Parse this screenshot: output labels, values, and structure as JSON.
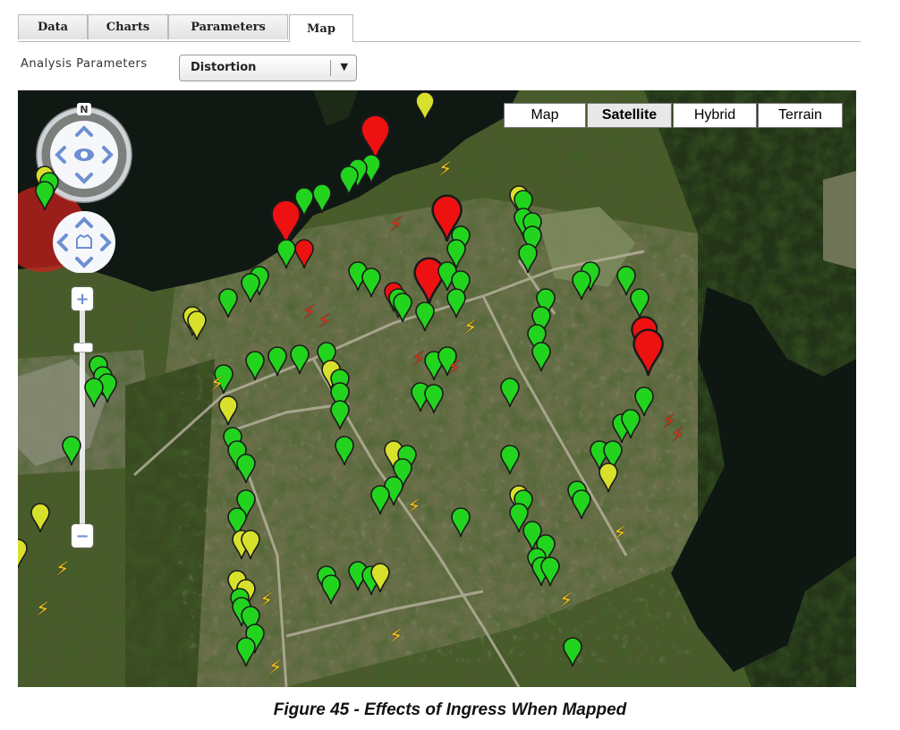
{
  "tabs": [
    {
      "label": "Data",
      "active": false
    },
    {
      "label": "Charts",
      "active": false
    },
    {
      "label": "Parameters",
      "active": false
    },
    {
      "label": "Map",
      "active": true
    }
  ],
  "params": {
    "label": "Analysis Parameters",
    "selected": "Distortion"
  },
  "map": {
    "types": [
      {
        "label": "Map",
        "active": false
      },
      {
        "label": "Satellite",
        "active": true
      },
      {
        "label": "Hybrid",
        "active": false
      },
      {
        "label": "Terrain",
        "active": false
      }
    ],
    "compass_label": "N",
    "zoom_in": "+",
    "zoom_out": "−",
    "marker_colors": {
      "green": "#22d41e",
      "yellow": "#d7e02b",
      "red": "#ee1111",
      "bolt_yellow": "#f2c21a",
      "bolt_red": "#e0321c"
    }
  },
  "caption": "Figure 45 - Effects of Ingress When Mapped"
}
